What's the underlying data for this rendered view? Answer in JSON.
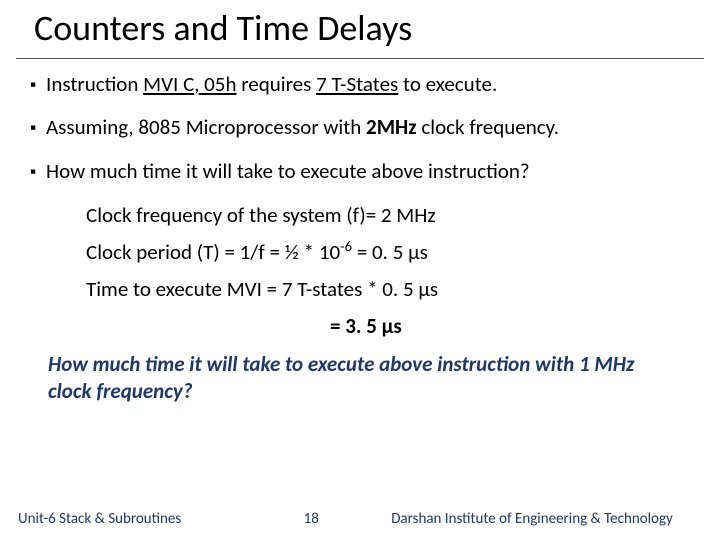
{
  "title": "Counters and Time Delays",
  "bullets": {
    "b1_pre": "Instruction ",
    "b1_u1": "MVI C, 05h",
    "b1_mid": " requires ",
    "b1_u2": "7 T-States",
    "b1_post": " to execute.",
    "b2_pre": "Assuming, 8085 Microprocessor with ",
    "b2_b": "2MHz",
    "b2_post": " clock frequency.",
    "b3": "How much time it will take to execute above instruction?"
  },
  "calc": {
    "line1": "Clock frequency of the system (f)= 2 MHz",
    "line2_pre": "Clock period (T) = 1/f = ½ * 10",
    "line2_sup": "-6",
    "line2_post": "  = 0. 5 μs",
    "line3": "Time to execute MVI  = 7 T-states * 0. 5 μs",
    "result": "= 3. 5 μs"
  },
  "question": "How much time it will take to execute above instruction with 1 MHz clock frequency?",
  "footer": {
    "left": "Unit-6 Stack & Subroutines",
    "page": "18",
    "right": "Darshan Institute of Engineering & Technology"
  }
}
